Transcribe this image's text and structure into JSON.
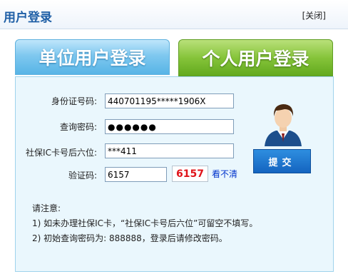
{
  "header": {
    "title": "用户登录",
    "close_label": "[关闭]"
  },
  "tabs": [
    {
      "label": "单位用户登录"
    },
    {
      "label": "个人用户登录"
    }
  ],
  "form": {
    "id_label": "身份证号码:",
    "id_value": "440701195*****1906X",
    "password_label": "查询密码:",
    "password_value": "●●●●●●",
    "card_label": "社保IC卡号后六位:",
    "card_value": "***411",
    "captcha_label": "验证码:",
    "captcha_value": "6157",
    "captcha_image_text": "6157",
    "refresh_label": "看不清",
    "submit_label": "提交"
  },
  "notes": {
    "heading": "请注意:",
    "items": [
      "1) 如未办理社保IC卡，“社保IC卡号后六位”可留空不填写。",
      "2) 初始查询密码为: 888888，登录后请修改密码。"
    ]
  }
}
